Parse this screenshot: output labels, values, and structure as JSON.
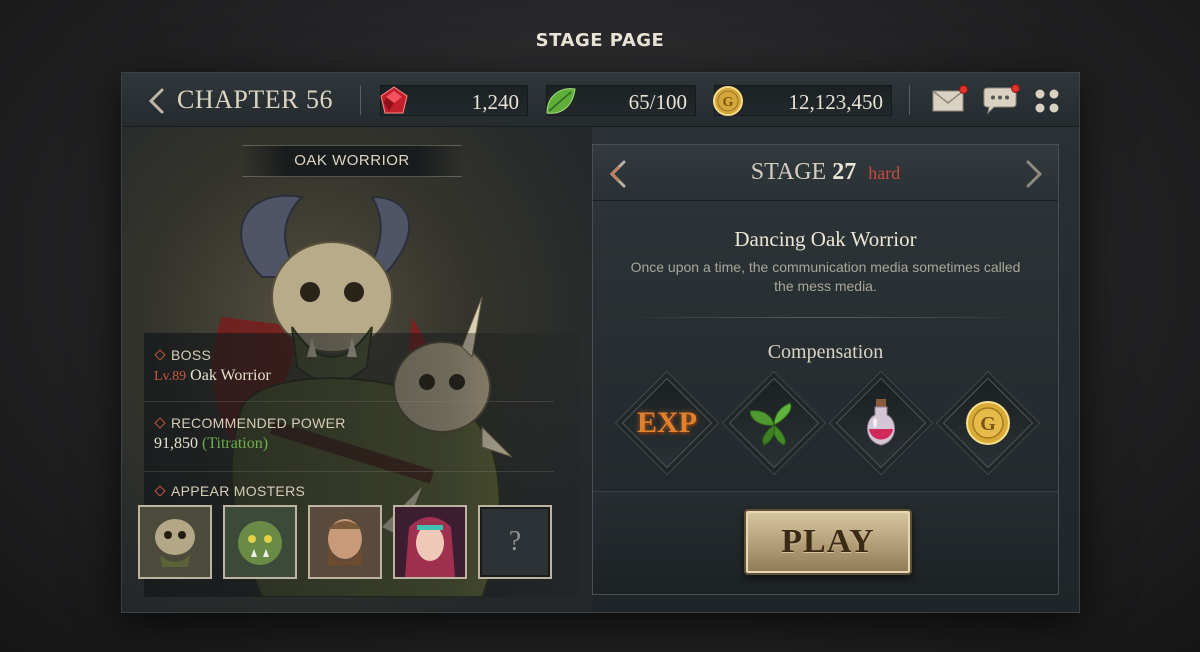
{
  "page": {
    "title": "STAGE PAGE"
  },
  "header": {
    "chapter": "CHAPTER 56",
    "resources": {
      "gems": "1,240",
      "stamina": "65/100",
      "gold": "12,123,450"
    },
    "icons": [
      "back-arrow-icon",
      "ruby-icon",
      "leaf-icon",
      "gold-coin-icon",
      "mail-icon",
      "chat-icon",
      "menu-grid-icon"
    ]
  },
  "boss_panel": {
    "name": "OAK WORRIOR",
    "boss_label": "BOSS",
    "boss_level": "Lv.89",
    "boss_name": "Oak Worrior",
    "power_label": "RECOMMENDED POWER",
    "power_value": "91,850",
    "power_note": "(Titration)",
    "monsters_label": "APPEAR MOSTERS",
    "unknown_monster": "?"
  },
  "stage": {
    "label": "STAGE",
    "number": "27",
    "difficulty": "hard",
    "name": "Dancing Oak Worrior",
    "description": "Once upon a time, the communication media sometimes called the mess media.",
    "compensation_label": "Compensation",
    "rewards": {
      "exp": "EXP"
    },
    "play_label": "PLAY"
  },
  "colors": {
    "accent_red": "#c94a3c",
    "accent_green": "#6fae4c",
    "gold": "#d4a73a",
    "play_button": "#b7a17a"
  }
}
